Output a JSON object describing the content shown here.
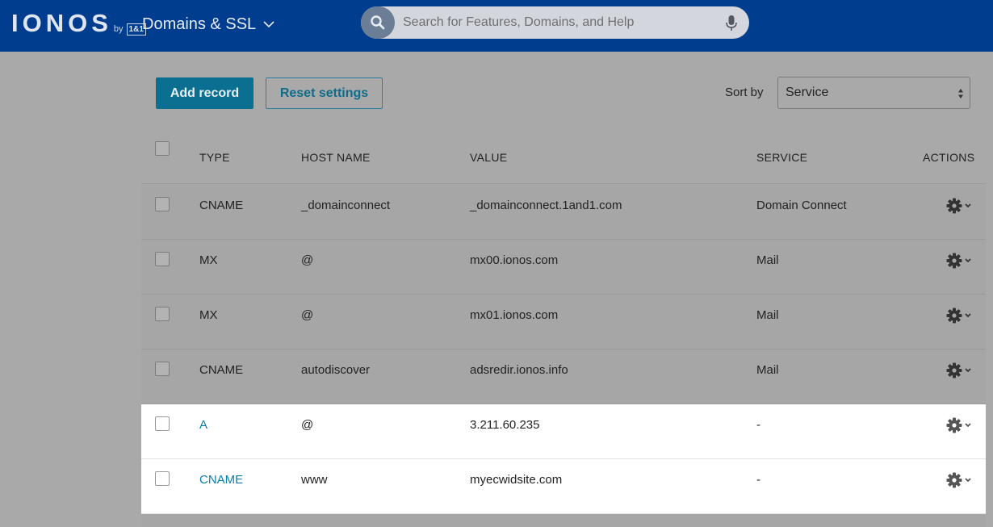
{
  "header": {
    "logo": "IONOS",
    "logo_by": "by",
    "logo_brand": "1&1",
    "section": "Domains & SSL",
    "search_placeholder": "Search for Features, Domains, and Help"
  },
  "toolbar": {
    "add_record": "Add record",
    "reset_settings": "Reset settings",
    "sort_by_label": "Sort by",
    "sort_by_value": "Service"
  },
  "table": {
    "columns": [
      "TYPE",
      "HOST NAME",
      "VALUE",
      "SERVICE",
      "ACTIONS"
    ],
    "rows": [
      {
        "type": "CNAME",
        "host": "_domainconnect",
        "value": "_domainconnect.1and1.com",
        "service": "Domain Connect"
      },
      {
        "type": "MX",
        "host": "@",
        "value": "mx00.ionos.com",
        "service": "Mail"
      },
      {
        "type": "MX",
        "host": "@",
        "value": "mx01.ionos.com",
        "service": "Mail"
      },
      {
        "type": "CNAME",
        "host": "autodiscover",
        "value": "adsredir.ionos.info",
        "service": "Mail"
      },
      {
        "type": "A",
        "host": "@",
        "value": "3.211.60.235",
        "service": "-"
      },
      {
        "type": "CNAME",
        "host": "www",
        "value": "myecwidsite.com",
        "service": "-"
      }
    ]
  },
  "colors": {
    "header_bg": "#003d8f",
    "accent": "#0a6f91",
    "link": "#0b7ea8"
  }
}
